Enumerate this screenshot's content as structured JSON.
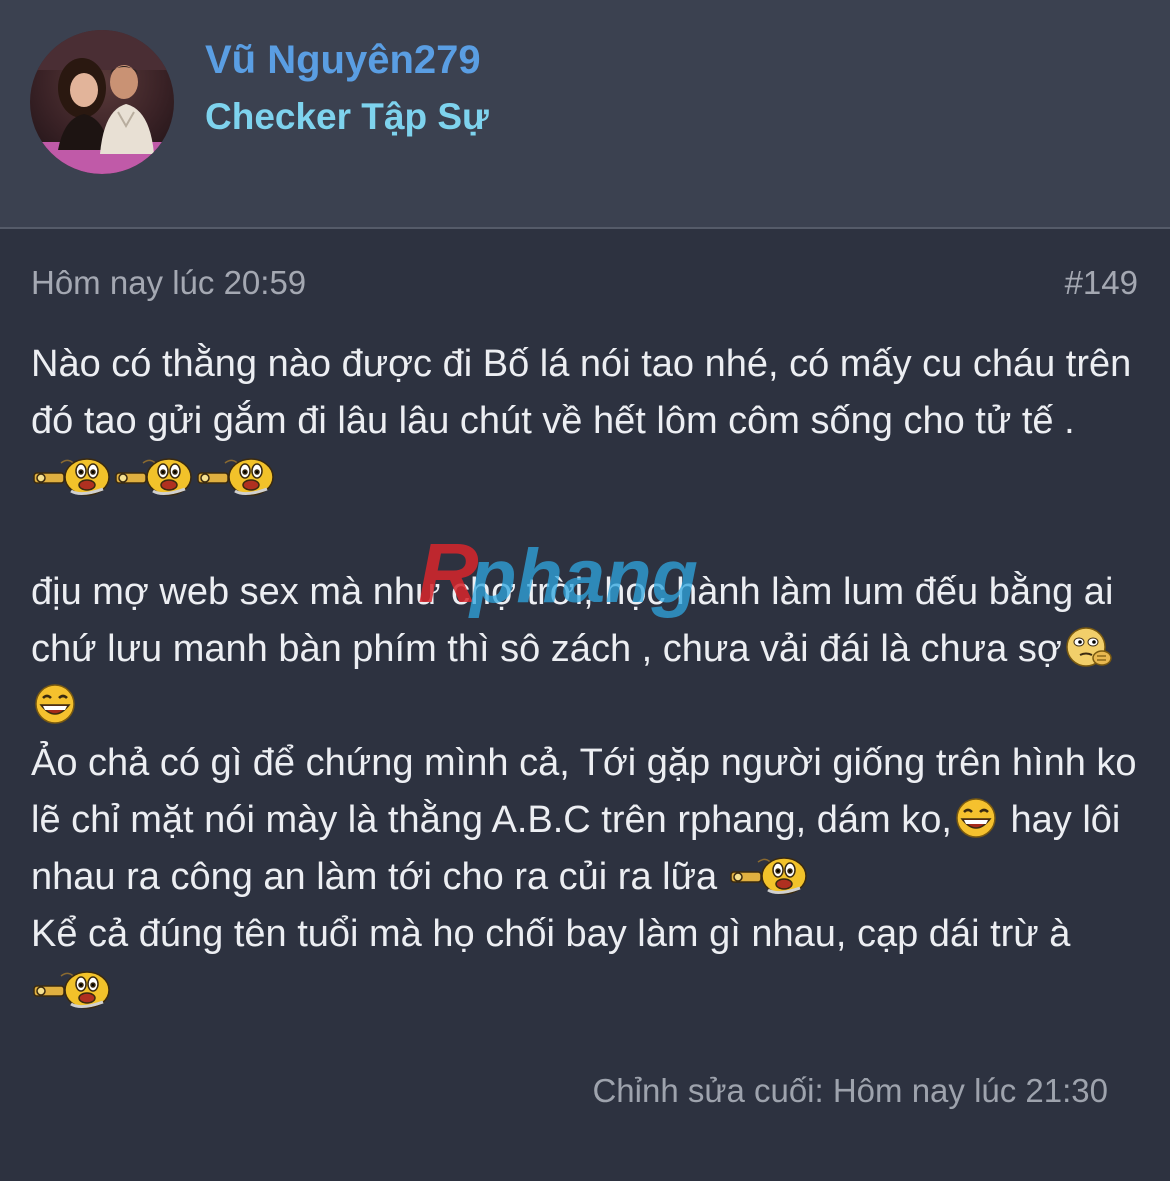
{
  "user": {
    "name": "Vũ Nguyên279",
    "title": "Checker Tập Sự",
    "name_color": "#5a9ee3",
    "title_color": "#7ed3ee"
  },
  "post": {
    "date": "Hôm nay lúc 20:59",
    "number": "#149",
    "paragraphs": [
      [
        {
          "text": "Nào có thằng nào được đi Bố lá nói tao nhé, có mấy cu cháu trên đó tao gửi gắm đi lâu lâu chút về hết lôm côm sống cho tử tế . "
        },
        {
          "smiley": "crazy-smiley"
        },
        {
          "smiley": "crazy-smiley"
        },
        {
          "smiley": "crazy-smiley"
        }
      ],
      [],
      [
        {
          "text": "địu mợ web sex mà như chợ trời, học hành làm lum đếu bằng ai chứ lưu manh bàn phím thì sô zách , chưa vải đái là chưa sợ"
        },
        {
          "smiley": "thinking-smiley"
        },
        {
          "smiley": "laughing-smiley"
        }
      ],
      [
        {
          "text": "Ảo chả có gì để chứng mình cả, Tới gặp người giống trên hình ko lẽ chỉ mặt nói mày là thằng A.B.C trên rphang, dám ko,"
        },
        {
          "smiley": "laughing-smiley"
        },
        {
          "text": " hay lôi nhau ra công an làm tới cho ra củi ra lữa "
        },
        {
          "smiley": "crazy-smiley"
        }
      ],
      [
        {
          "text": "Kể cả đúng tên tuổi mà họ chối bay làm gì nhau, cạp dái trừ à "
        },
        {
          "smiley": "crazy-smiley"
        }
      ]
    ],
    "edited": "Chỉnh sửa cuối: Hôm nay lúc 21:30"
  },
  "watermark": {
    "text": "Rphang",
    "color_r": "#d8262c",
    "color_rest": "#2fa7e0"
  },
  "colors": {
    "background": "#2d3240",
    "header_background": "#3b4150",
    "body_text": "#eceef2",
    "meta_text": "#a4a8b2"
  }
}
